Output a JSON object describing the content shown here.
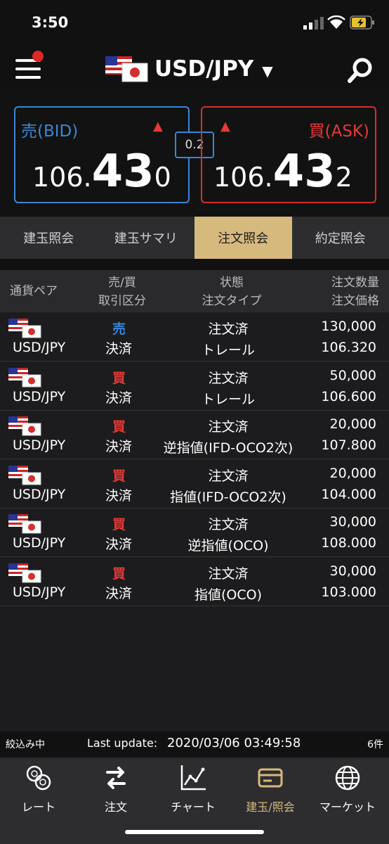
{
  "status_bar": {
    "time": "3:50"
  },
  "header": {
    "pair": "USD/JPY"
  },
  "quotes": {
    "bid": {
      "label": "売(BID)",
      "price_prefix": "106.",
      "price_main": "43",
      "price_suffix": "0"
    },
    "ask": {
      "label": "買(ASK)",
      "price_prefix": "106.",
      "price_main": "43",
      "price_suffix": "2"
    },
    "spread": "0.2"
  },
  "tabs": [
    {
      "label": "建玉照会"
    },
    {
      "label": "建玉サマリ"
    },
    {
      "label": "注文照会",
      "active": true
    },
    {
      "label": "約定照会"
    }
  ],
  "table": {
    "headers": {
      "pair": "通貨ペア",
      "side_top": "売/買",
      "side_bottom": "取引区分",
      "status_top": "状態",
      "status_bottom": "注文タイプ",
      "qty_top": "注文数量",
      "qty_bottom": "注文価格"
    },
    "rows": [
      {
        "pair": "USD/JPY",
        "side": "売",
        "category": "決済",
        "status": "注文済",
        "type": "トレール",
        "qty": "130,000",
        "price": "106.320"
      },
      {
        "pair": "USD/JPY",
        "side": "買",
        "category": "決済",
        "status": "注文済",
        "type": "トレール",
        "qty": "50,000",
        "price": "106.600"
      },
      {
        "pair": "USD/JPY",
        "side": "買",
        "category": "決済",
        "status": "注文済",
        "type": "逆指値(IFD-OCO2次)",
        "qty": "20,000",
        "price": "107.800"
      },
      {
        "pair": "USD/JPY",
        "side": "買",
        "category": "決済",
        "status": "注文済",
        "type": "指値(IFD-OCO2次)",
        "qty": "20,000",
        "price": "104.000"
      },
      {
        "pair": "USD/JPY",
        "side": "買",
        "category": "決済",
        "status": "注文済",
        "type": "逆指値(OCO)",
        "qty": "30,000",
        "price": "108.000"
      },
      {
        "pair": "USD/JPY",
        "side": "買",
        "category": "決済",
        "status": "注文済",
        "type": "指値(OCO)",
        "qty": "30,000",
        "price": "103.000"
      }
    ]
  },
  "footer": {
    "filter": "絞込み中",
    "last_update_label": "Last update:",
    "last_update": "2020/03/06 03:49:58",
    "count": "6件"
  },
  "nav": [
    {
      "label": "レート",
      "icon": "rate-icon"
    },
    {
      "label": "注文",
      "icon": "order-icon"
    },
    {
      "label": "チャート",
      "icon": "chart-icon"
    },
    {
      "label": "建玉/照会",
      "icon": "position-icon",
      "active": true
    },
    {
      "label": "マーケット",
      "icon": "globe-icon"
    }
  ],
  "colors": {
    "accent": "#d6b97c",
    "buy": "#e53935",
    "sell": "#3a86d6"
  }
}
